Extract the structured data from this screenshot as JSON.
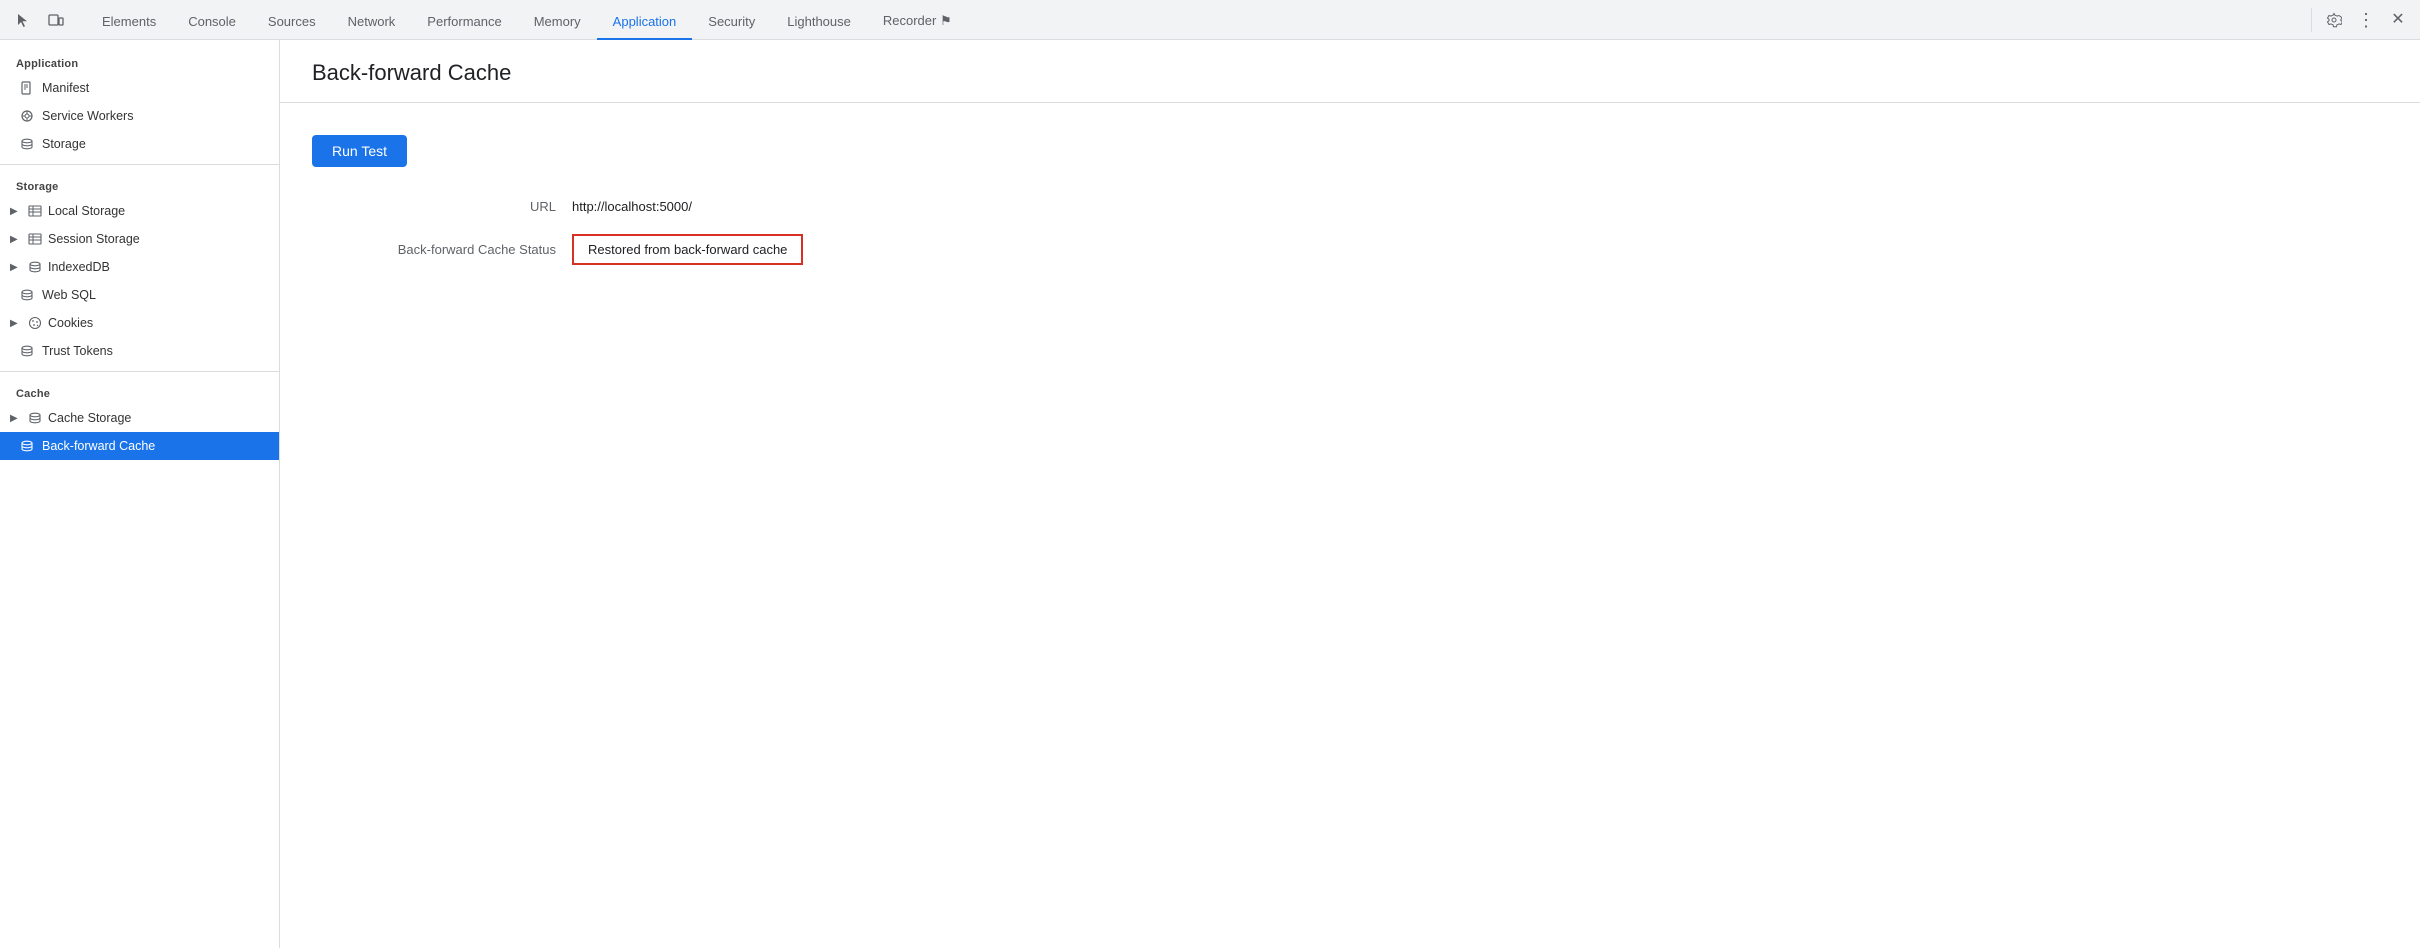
{
  "tabs": {
    "items": [
      {
        "label": "Elements",
        "active": false
      },
      {
        "label": "Console",
        "active": false
      },
      {
        "label": "Sources",
        "active": false
      },
      {
        "label": "Network",
        "active": false
      },
      {
        "label": "Performance",
        "active": false
      },
      {
        "label": "Memory",
        "active": false
      },
      {
        "label": "Application",
        "active": true
      },
      {
        "label": "Security",
        "active": false
      },
      {
        "label": "Lighthouse",
        "active": false
      },
      {
        "label": "Recorder ⚑",
        "active": false
      }
    ]
  },
  "sidebar": {
    "application_title": "Application",
    "manifest_label": "Manifest",
    "service_workers_label": "Service Workers",
    "storage_label": "Storage",
    "storage_section_title": "Storage",
    "local_storage_label": "Local Storage",
    "session_storage_label": "Session Storage",
    "indexed_db_label": "IndexedDB",
    "web_sql_label": "Web SQL",
    "cookies_label": "Cookies",
    "trust_tokens_label": "Trust Tokens",
    "cache_section_title": "Cache",
    "cache_storage_label": "Cache Storage",
    "back_forward_cache_label": "Back-forward Cache"
  },
  "content": {
    "title": "Back-forward Cache",
    "run_test_button": "Run Test",
    "url_label": "URL",
    "url_value": "http://localhost:5000/",
    "cache_status_label": "Back-forward Cache Status",
    "cache_status_value": "Restored from back-forward cache"
  },
  "toolbar": {
    "settings_tooltip": "Settings",
    "more_tooltip": "More options",
    "close_tooltip": "Close"
  }
}
